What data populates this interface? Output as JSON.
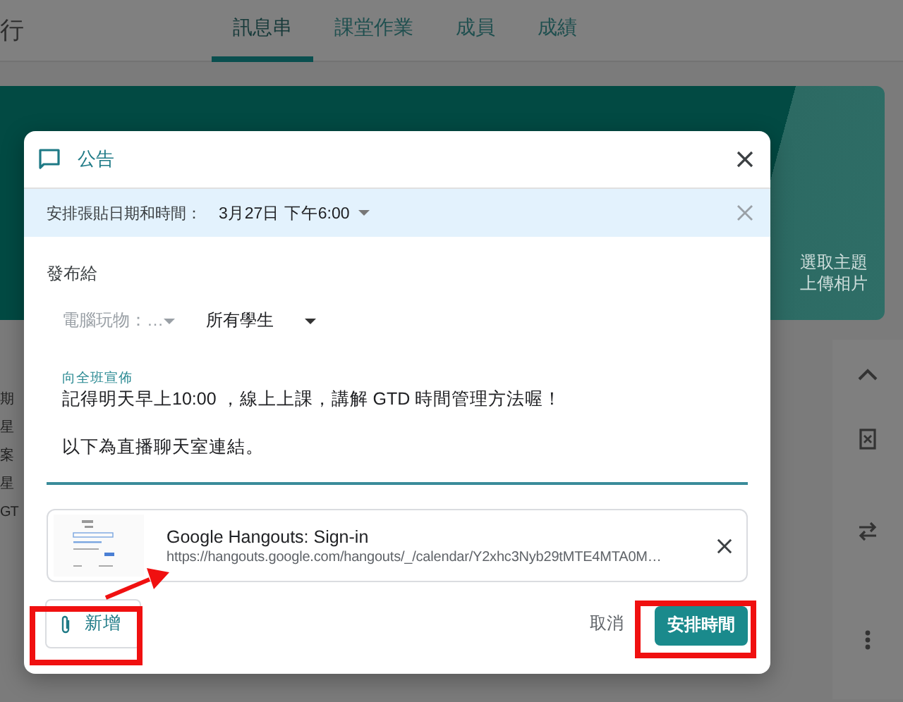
{
  "header": {
    "title_fragment": "行",
    "tabs": [
      {
        "label": "訊息串",
        "selected": true
      },
      {
        "label": "課堂作業",
        "selected": false
      },
      {
        "label": "成員",
        "selected": false
      },
      {
        "label": "成績",
        "selected": false
      }
    ]
  },
  "banner": {
    "links": [
      "選取主題",
      "上傳相片"
    ]
  },
  "stream_fragments": [
    "期",
    "星",
    "案",
    "星",
    "GT"
  ],
  "dialog": {
    "title": "公告",
    "schedule": {
      "label": "安排張貼日期和時間：",
      "value": "3月27日 下午6:00"
    },
    "audience_label": "發布給",
    "class_select": {
      "value": "電腦玩物：…",
      "disabled": true
    },
    "students_select": {
      "value": "所有學生",
      "disabled": false
    },
    "message": {
      "label": "向全班宣佈",
      "lines": [
        "記得明天早上10:00 ，線上上課，講解 GTD 時間管理方法喔！",
        "以下為直播聊天室連結。"
      ]
    },
    "attachment": {
      "title": "Google Hangouts: Sign-in",
      "url": "https://hangouts.google.com/hangouts/_/calendar/Y2xhc3Nyb29tMTE4MTA0M…"
    },
    "buttons": {
      "add": "新增",
      "cancel": "取消",
      "submit": "安排時間"
    }
  }
}
